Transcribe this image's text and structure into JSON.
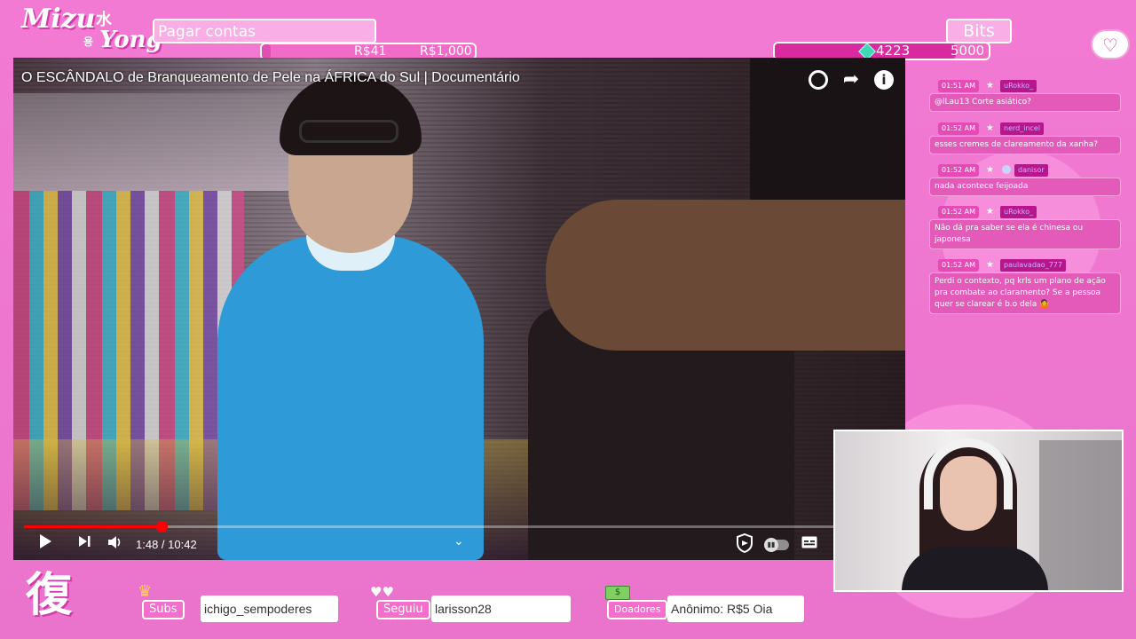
{
  "overlay": {
    "logo": {
      "word1": "Mizu",
      "word2": "Yong",
      "kanji": "水",
      "kanji2": "용"
    },
    "goal": {
      "label": "Pagar contas",
      "current": "R$41",
      "target": "R$1,000",
      "progress": 0.041
    },
    "bits": {
      "label": "Bits",
      "current": "4223",
      "target": "5000",
      "progress": 0.8446
    },
    "bottom_logo": "復"
  },
  "video": {
    "title": "O ESCÂNDALO de Branqueamento de Pele na ÁFRICA do Sul | Documentário",
    "time": "1:48 / 10:42",
    "progress": 0.168,
    "icons": [
      "clock-icon",
      "share-icon",
      "info-icon",
      "play-icon",
      "next-icon",
      "volume-icon",
      "chevron-up-icon",
      "shield-icon",
      "autoplay-toggle",
      "captions-icon"
    ]
  },
  "chat": {
    "messages": [
      {
        "time": "01:51 AM",
        "user": "uRokko_",
        "text": "@lLau13 Corte asiático?",
        "verified": false
      },
      {
        "time": "01:52 AM",
        "user": "nerd_incel",
        "text": "esses cremes de clareamento da xanha?",
        "verified": false
      },
      {
        "time": "01:52 AM",
        "user": "danisor",
        "text": "nada acontece feijoada",
        "verified": true
      },
      {
        "time": "01:52 AM",
        "user": "uRokko_",
        "text": "Não dá pra saber se ela é chinesa ou japonesa",
        "verified": false
      },
      {
        "time": "01:52 AM",
        "user": "paulavadao_777",
        "text": "Perdi o contexto, pq krls um plano de ação pra combate ao claramento? Se a pessoa quer se clarear é b.o dela 🤷",
        "verified": false
      }
    ]
  },
  "bottom_bar": {
    "subs_label": "Subs",
    "subs_value": "ichigo_sempoderes",
    "follow_label": "Seguiu",
    "follow_value": "larisson28",
    "donors_label": "Doadores",
    "donors_value": "Anônimo: R$5    Oia"
  },
  "colors": {
    "background": "#f07ad0",
    "accent": "#d92aa0",
    "video_red": "#ff0000"
  }
}
